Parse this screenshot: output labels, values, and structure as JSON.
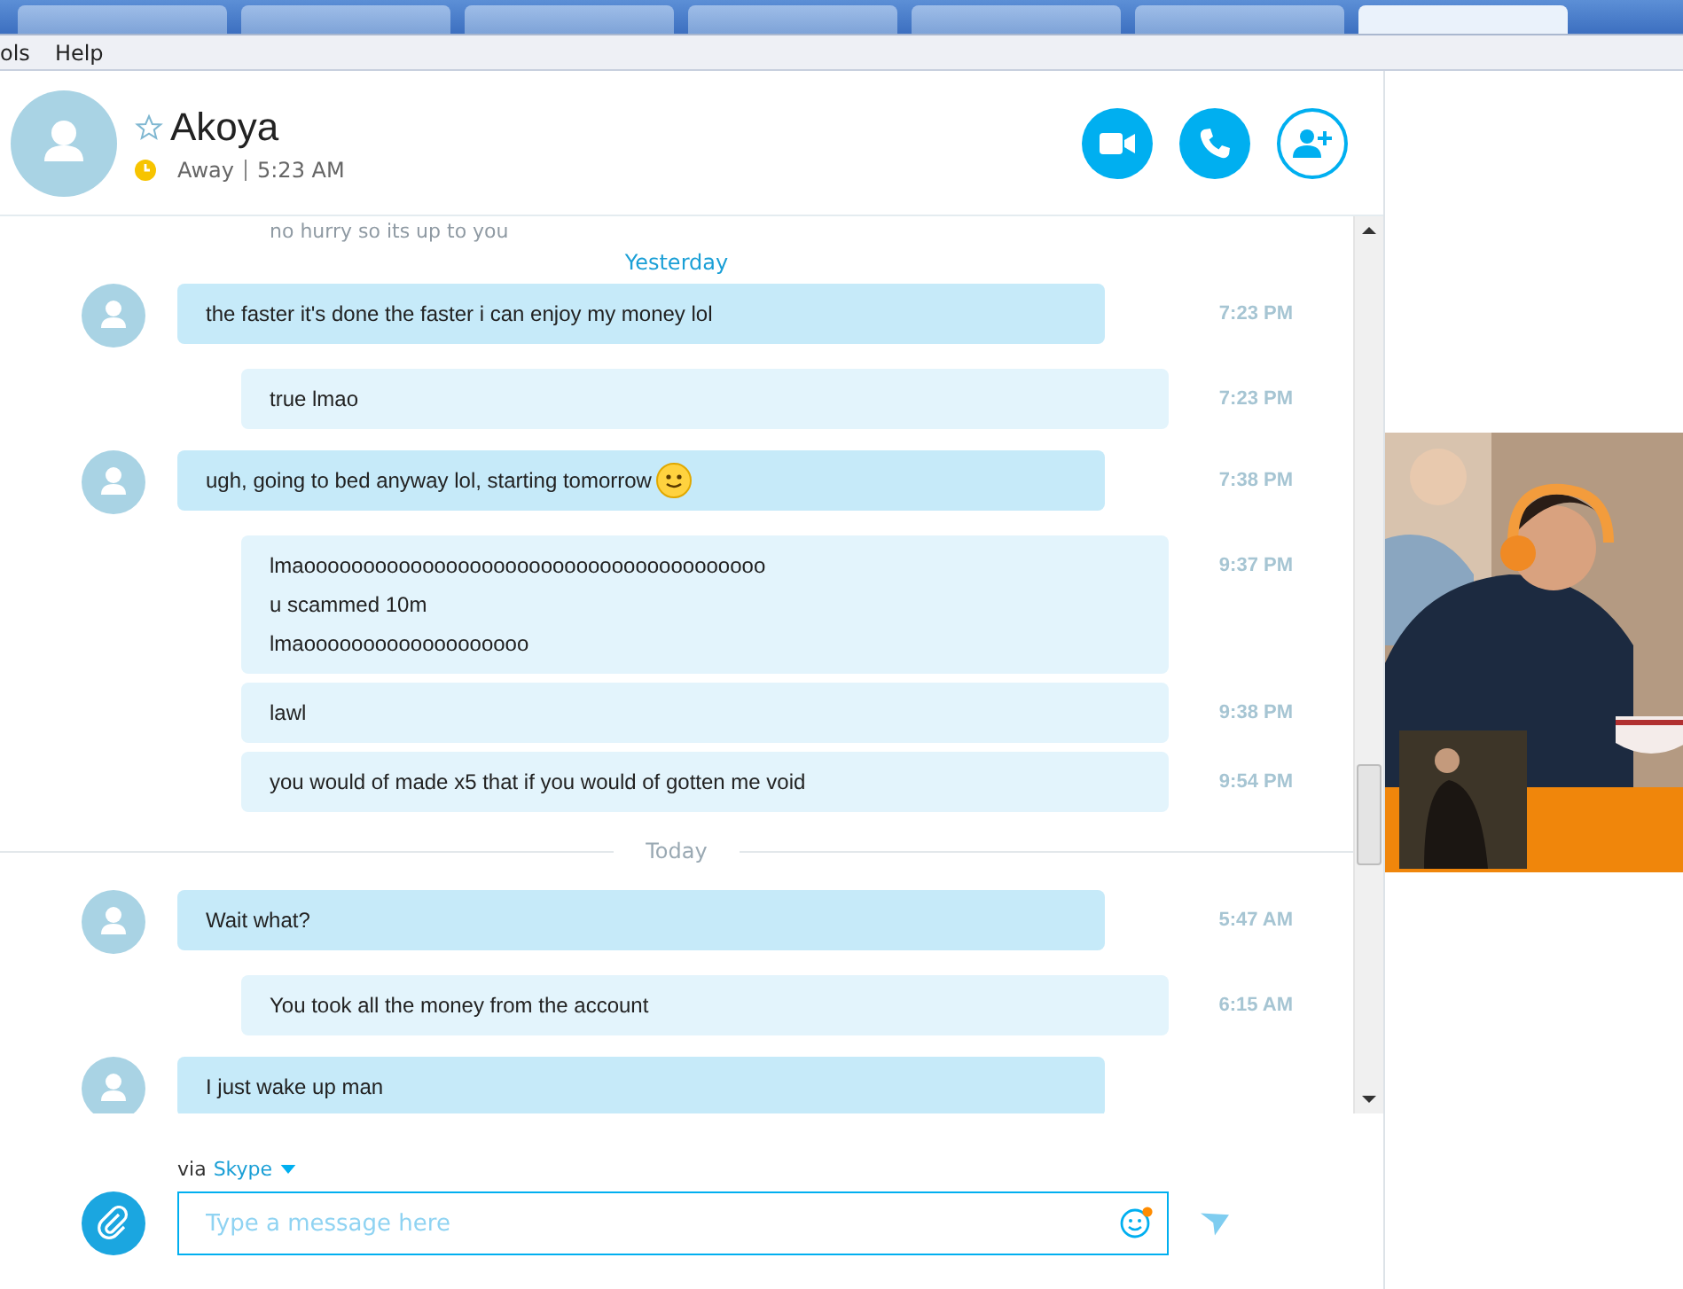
{
  "browser_tabs": [
    {
      "selected": false
    },
    {
      "selected": false
    },
    {
      "selected": false
    },
    {
      "selected": false
    },
    {
      "selected": false
    },
    {
      "selected": false
    },
    {
      "selected": true
    }
  ],
  "menu": [
    "ols",
    "Help"
  ],
  "contact": {
    "name": "Akoya",
    "favorite": false,
    "status_text": "Away",
    "time": "5:23 AM"
  },
  "header_buttons": [
    {
      "kind": "video"
    },
    {
      "kind": "call"
    },
    {
      "kind": "add_contact"
    }
  ],
  "timeline": [
    {
      "kind": "faded",
      "lines": [
        "no hurry so its up to you"
      ]
    },
    {
      "kind": "date_sticky",
      "label": "Yesterday"
    },
    {
      "kind": "incoming",
      "lines": [
        "the faster it's done the faster i can enjoy my money lol"
      ],
      "time": "7:23 PM"
    },
    {
      "kind": "outgoing",
      "lines": [
        "true lmao"
      ],
      "time": "7:23 PM"
    },
    {
      "kind": "incoming",
      "lines": [
        "ugh, going to bed anyway lol, starting tomorrow"
      ],
      "emoticon": true,
      "time": "7:38 PM"
    },
    {
      "kind": "outgoing",
      "lines": [
        "lmaooooooooooooooooooooooooooooooooooooooo",
        "u scammed 10m",
        "lmaooooooooooooooooooo"
      ],
      "time": "9:37 PM"
    },
    {
      "kind": "outgoing",
      "lines": [
        "lawl"
      ],
      "time": "9:38 PM"
    },
    {
      "kind": "outgoing",
      "lines": [
        "you would of made x5 that if you would of gotten me void"
      ],
      "time": "9:54 PM"
    },
    {
      "kind": "date_divider",
      "label": "Today"
    },
    {
      "kind": "incoming",
      "lines": [
        "Wait what?"
      ],
      "time": "5:47 AM"
    },
    {
      "kind": "outgoing",
      "lines": [
        "You took all the money from the account"
      ],
      "time": "6:15 AM"
    },
    {
      "kind": "incoming",
      "lines": [
        "I just wake up man"
      ]
    }
  ],
  "composer": {
    "via_label": "via",
    "via_service": "Skype",
    "placeholder": "Type a message here",
    "emoticon_notification": true
  },
  "ad": {
    "kind": "picture"
  }
}
